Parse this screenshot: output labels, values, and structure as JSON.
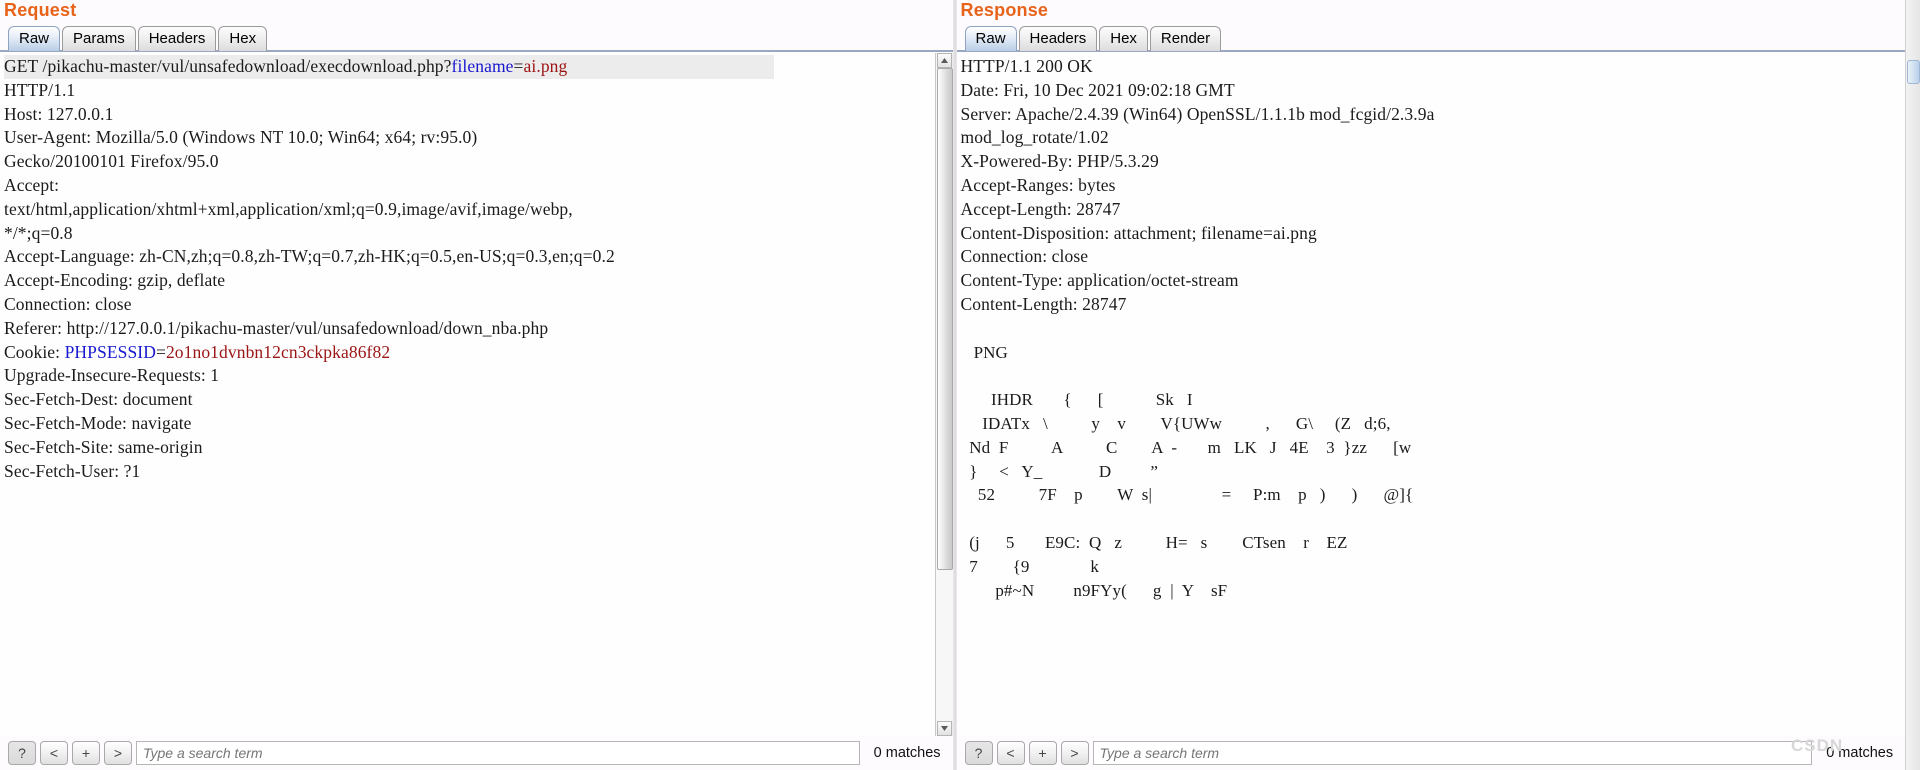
{
  "request": {
    "title": "Request",
    "tabs": [
      {
        "label": "Raw",
        "active": true
      },
      {
        "label": "Params",
        "active": false
      },
      {
        "label": "Headers",
        "active": false
      },
      {
        "label": "Hex",
        "active": false
      }
    ],
    "first_line": {
      "method_and_path": "GET /pikachu-master/vul/unsafedownload/execdownload.php?",
      "param_name": "filename",
      "equals": "=",
      "param_value": "ai.png"
    },
    "lines": [
      "HTTP/1.1",
      "Host: 127.0.0.1",
      "User-Agent: Mozilla/5.0 (Windows NT 10.0; Win64; x64; rv:95.0)",
      "Gecko/20100101 Firefox/95.0",
      "Accept:",
      "text/html,application/xhtml+xml,application/xml;q=0.9,image/avif,image/webp,",
      "*/*;q=0.8",
      "Accept-Language: zh-CN,zh;q=0.8,zh-TW;q=0.7,zh-HK;q=0.5,en-US;q=0.3,en;q=0.2",
      "Accept-Encoding: gzip, deflate",
      "Connection: close",
      "Referer: http://127.0.0.1/pikachu-master/vul/unsafedownload/down_nba.php"
    ],
    "cookie_line": {
      "prefix": "Cookie: ",
      "key": "PHPSESSID",
      "equals": "=",
      "value": "2o1no1dvnbn12cn3ckpka86f82"
    },
    "lines_after_cookie": [
      "Upgrade-Insecure-Requests: 1",
      "Sec-Fetch-Dest: document",
      "Sec-Fetch-Mode: navigate",
      "Sec-Fetch-Site: same-origin",
      "Sec-Fetch-User: ?1"
    ],
    "search": {
      "help_label": "?",
      "prev_label": "<",
      "add_label": "+",
      "next_label": ">",
      "placeholder": "Type a search term",
      "value": "",
      "matches": "0 matches"
    }
  },
  "response": {
    "title": "Response",
    "tabs": [
      {
        "label": "Raw",
        "active": true
      },
      {
        "label": "Headers",
        "active": false
      },
      {
        "label": "Hex",
        "active": false
      },
      {
        "label": "Render",
        "active": false
      }
    ],
    "lines": [
      "HTTP/1.1 200 OK",
      "Date: Fri, 10 Dec 2021 09:02:18 GMT",
      "Server: Apache/2.4.39 (Win64) OpenSSL/1.1.1b mod_fcgid/2.3.9a",
      "mod_log_rotate/1.02",
      "X-Powered-By: PHP/5.3.29",
      "Accept-Ranges: bytes",
      "Accept-Length: 28747",
      "Content-Disposition: attachment; filename=ai.png",
      "Connection: close",
      "Content-Type: application/octet-stream",
      "Content-Length: 28747"
    ],
    "body_lines": [
      "",
      "   PNG",
      "",
      "       IHDR       {      [            Sk   I",
      "     IDATx   \\          y    v        V{UWw          ,      G\\     (Z   d;6,",
      "  Nd  F          A          C        A  -       m   LK   J   4E    3  }zz      [w",
      "  }     <   Y_             D         ”",
      "    52          7F    p        W  s|                =     P:m    p   )      )      @]{",
      "",
      "  (j      5       E9C:  Q   z          H=   s        CTsen    r    EZ",
      "  7        {9              k",
      "        p#~N         n9FYy(      g  |  Y    sF"
    ],
    "search": {
      "help_label": "?",
      "prev_label": "<",
      "add_label": "+",
      "next_label": ">",
      "placeholder": "Type a search term",
      "value": "",
      "matches": "0 matches"
    }
  },
  "watermark": "CSDN",
  "colors": {
    "title": "#e8631a",
    "param_key": "#1818d0",
    "param_value": "#9b1414",
    "tab_active": "#b9cde6"
  }
}
